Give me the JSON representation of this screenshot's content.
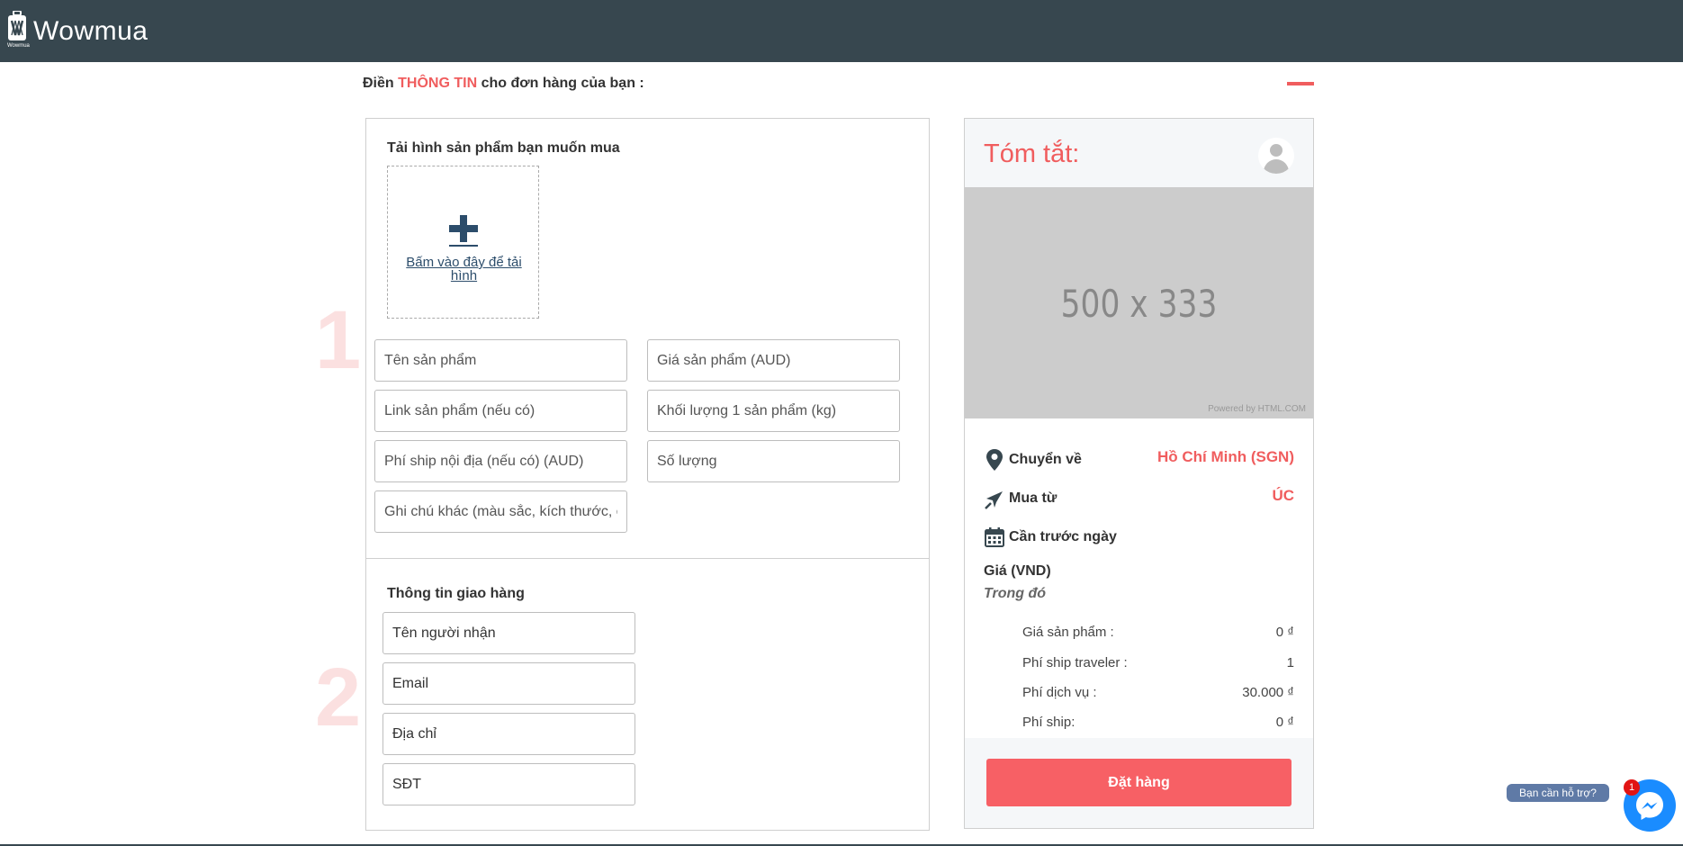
{
  "app": {
    "name": "Wowmua",
    "logo_sub": "Wowmua"
  },
  "heading": {
    "prefix": "Điền",
    "accent": "THÔNG TIN",
    "suffix": "cho đơn hàng của bạn :"
  },
  "steps": [
    "1",
    "2"
  ],
  "product_section": {
    "title": "Tải hình sản phẩm bạn muốn mua",
    "upload_label": "Bấm vào đây để tải hình",
    "fields": {
      "product_name": "Tên sản phẩm",
      "product_price": "Giá sản phẩm (AUD)",
      "product_link": "Link sản phẩm (nếu có)",
      "product_weight": "Khối lượng 1 sản phẩm (kg)",
      "domestic_ship": "Phí ship nội địa (nếu có) (AUD)",
      "quantity": "Số lượng",
      "notes": "Ghi chú khác (màu sắc, kích thước, chất liệu...)"
    }
  },
  "delivery_section": {
    "title": "Thông tin giao hàng",
    "fields": {
      "recipient": "Tên người nhận",
      "email": "Email",
      "address": "Địa chỉ",
      "phone": "SĐT"
    }
  },
  "summary": {
    "title": "Tóm tắt:",
    "image_text": "500 x 333",
    "image_credit": "Powered by HTML.COM",
    "ship_to_label": "Chuyển về",
    "ship_to_value": "Hồ Chí Minh (SGN)",
    "buy_from_label": "Mua từ",
    "buy_from_value": "ÚC",
    "need_before_label": "Cần trước ngày",
    "price_title": "Giá (VND)",
    "price_sub": "Trong đó",
    "lines": [
      {
        "label": "Giá sản phẩm :",
        "value": "0 ₫"
      },
      {
        "label": "Phí ship traveler :",
        "value": "1"
      },
      {
        "label": "Phí dịch vụ :",
        "value": "30.000 ₫"
      },
      {
        "label": "Phí ship:",
        "value": "0 ₫"
      }
    ],
    "order_button": "Đặt hàng"
  },
  "support": {
    "label": "Bạn cần hỗ trợ?",
    "badge": "1"
  },
  "colors": {
    "topbar": "#37474f",
    "accent": "#f05d5e",
    "button": "#f76065",
    "messenger": "#1a8cff"
  },
  "icons": [
    "logo-icon",
    "plus-icon",
    "map-pin-icon",
    "plane-icon",
    "calendar-icon",
    "avatar-icon",
    "messenger-icon"
  ]
}
